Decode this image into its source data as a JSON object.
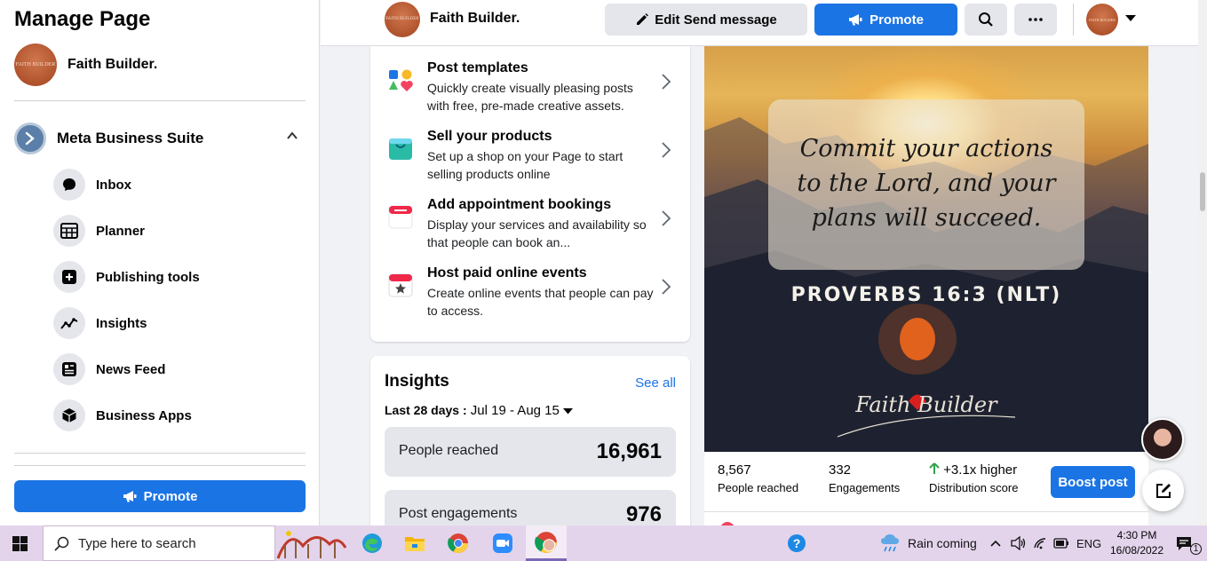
{
  "sidebar": {
    "title": "Manage Page",
    "page_name": "Faith Builder.",
    "avatar_text": "FAITH BUILDER",
    "suite_label": "Meta Business Suite",
    "items": [
      {
        "label": "Inbox",
        "icon": "chat-bubble-icon"
      },
      {
        "label": "Planner",
        "icon": "calendar-grid-icon"
      },
      {
        "label": "Publishing tools",
        "icon": "publishing-tools-icon"
      },
      {
        "label": "Insights",
        "icon": "insights-graph-icon"
      },
      {
        "label": "News Feed",
        "icon": "news-feed-icon"
      },
      {
        "label": "Business Apps",
        "icon": "cube-icon"
      }
    ],
    "promote_label": "Promote"
  },
  "header": {
    "page_name": "Faith Builder.",
    "edit_label": "Edit Send message",
    "promote_label": "Promote"
  },
  "tools": [
    {
      "title": "Post templates",
      "desc": "Quickly create visually pleasing posts with free, pre-made creative assets."
    },
    {
      "title": "Sell your products",
      "desc": "Set up a shop on your Page to start selling products online"
    },
    {
      "title": "Add appointment bookings",
      "desc": "Display your services and availability so that people can book an..."
    },
    {
      "title": "Host paid online events",
      "desc": "Create online events that people can pay to access."
    }
  ],
  "insights": {
    "title": "Insights",
    "see_all": "See all",
    "range_label": "Last 28 days :",
    "range_value": "Jul 19 - Aug 15",
    "metrics": [
      {
        "label": "People reached",
        "value": "16,961"
      },
      {
        "label": "Post engagements",
        "value": "976"
      }
    ]
  },
  "post": {
    "quote": "Commit your actions\nto the Lord, and your\nplans will succeed.",
    "verse": "PROVERBS 16:3 (NLT)",
    "signature": "Faith Builder",
    "stats": [
      {
        "value": "8,567",
        "label": "People reached"
      },
      {
        "value": "332",
        "label": "Engagements"
      },
      {
        "value": "+3.1x higher",
        "label": "Distribution score"
      }
    ],
    "boost_label": "Boost post"
  },
  "taskbar": {
    "search_placeholder": "Type here to search",
    "weather": "Rain coming",
    "language": "ENG",
    "time": "4:30 PM",
    "date": "16/08/2022",
    "notification_count": "1"
  },
  "colors": {
    "accent": "#1b74e4",
    "growth": "#31a24c",
    "taskbar": "#e3d4ec"
  }
}
